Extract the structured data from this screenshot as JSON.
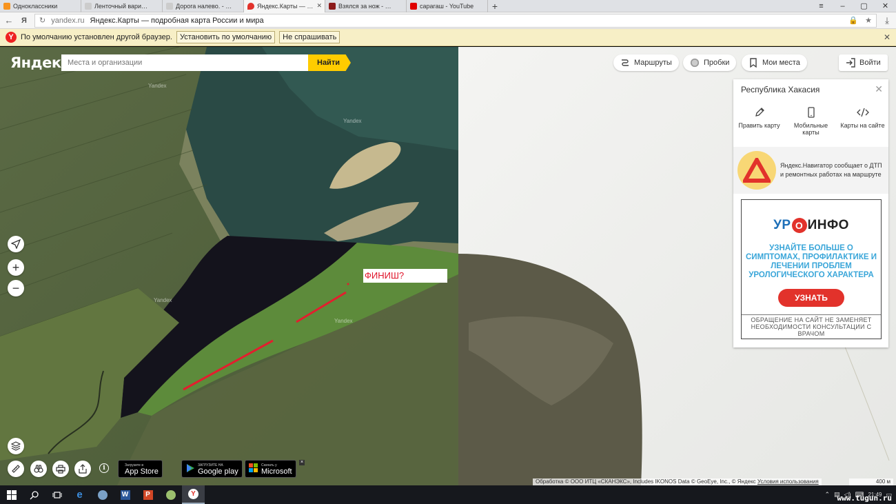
{
  "browser": {
    "tabs": [
      {
        "label": "Одноклассники",
        "color": "#f7931e",
        "active": false
      },
      {
        "label": "Ленточный вариант",
        "color": "#bbbbbb",
        "active": false
      },
      {
        "label": "Дорога налево. - Фот",
        "color": "#bbbbbb",
        "active": false
      },
      {
        "label": "Яндекс.Карты — подр",
        "color": "#e2322b",
        "active": true
      },
      {
        "label": "Взялся за нож - ЯПла",
        "color": "#8b1a1a",
        "active": false
      },
      {
        "label": "сарагаш - YouTube",
        "color": "#e00000",
        "active": false
      }
    ],
    "new_tab": "+",
    "window_controls": [
      "≡",
      "–",
      "▢",
      "✕"
    ],
    "address": {
      "domain": "yandex.ru",
      "page_title": "Яндекс.Карты — подробная карта России и мира"
    },
    "infobar": {
      "message": "По умолчанию установлен другой браузер.",
      "set_default": "Установить по умолчанию",
      "dont_ask": "Не спрашивать",
      "close": "✕"
    }
  },
  "map": {
    "logo": "Яндекс",
    "search_placeholder": "Места и организации",
    "search_button": "Найти",
    "top_buttons": {
      "routes": "Маршруты",
      "traffic": "Пробки",
      "my_places": "Мои места",
      "login": "Войти"
    },
    "panel": {
      "title": "Республика Хакасия",
      "actions": [
        "Править карту",
        "Мобильные карты",
        "Карты на сайте"
      ],
      "navigator_ad": "Яндекс.Навигатор сообщает о ДТП и ремонтных работах на маршруте",
      "banner": {
        "brand_left": "УР",
        "brand_o": "О",
        "brand_right": "ИНФО",
        "message": "УЗНАЙТЕ БОЛЬШЕ О СИМПТОМАХ, ПРОФИЛАКТИКЕ И ЛЕЧЕНИИ ПРОБЛЕМ УРОЛОГИЧЕСКОГО ХАРАКТЕРА",
        "cta": "УЗНАТЬ",
        "disclaimer": "ОБРАЩЕНИЕ НА САЙТ НЕ ЗАМЕНЯЕТ НЕОБХОДИМОСТИ КОНСУЛЬТАЦИИ С ВРАЧОМ"
      }
    },
    "annotation": "ФИНИШ?",
    "stores": [
      {
        "small": "Загрузите в",
        "large": "App Store"
      },
      {
        "small": "ЗАГРУЗИТЕ НА",
        "large": "Google play"
      },
      {
        "small": "Скачать у",
        "large": "Microsoft"
      }
    ],
    "store_close": "×",
    "info": "i",
    "copyright": "Обработка © ООО ИТЦ «СКАНЭКС», Includes IKONOS Data © GeoEye, Inc., © Яндекс",
    "terms": "Условия использования",
    "scale": "400 м",
    "watermark": "Yandex"
  },
  "taskbar": {
    "time": "21:49",
    "watermark": "www.tugun.ru"
  }
}
